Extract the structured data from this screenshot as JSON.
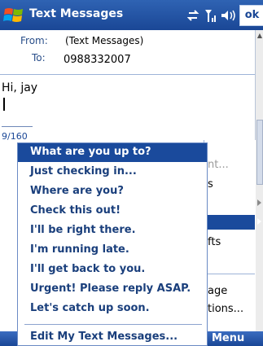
{
  "title_bar": {
    "app_title": "Text Messages",
    "ok_label": "ok",
    "icons": [
      "windows-start-icon",
      "sync-icon",
      "signal-icon",
      "volume-icon"
    ]
  },
  "header": {
    "from_label": "From:",
    "from_value": "(Text Messages)",
    "to_label": "To:",
    "to_value": "0988332007"
  },
  "message": {
    "body": "Hi, jay",
    "char_count": "9/160"
  },
  "background_menu": {
    "items": [
      "nt...",
      "s",
      "fts",
      "age",
      "tions..."
    ]
  },
  "popup_menu": {
    "items": [
      "What are you up to?",
      "Just checking in...",
      "Where are you?",
      "Check this out!",
      "I'll be right there.",
      "I'm running late.",
      "I'll get back to you.",
      "Urgent! Please reply ASAP.",
      "Let's catch up soon."
    ],
    "edit_label": "Edit My Text Messages...",
    "selected_index": 0
  },
  "softkeys": {
    "right": "Menu"
  },
  "colors": {
    "title_bar": "#1a4796",
    "highlight": "#1a4a9c",
    "menu_text": "#1a3f7c"
  }
}
